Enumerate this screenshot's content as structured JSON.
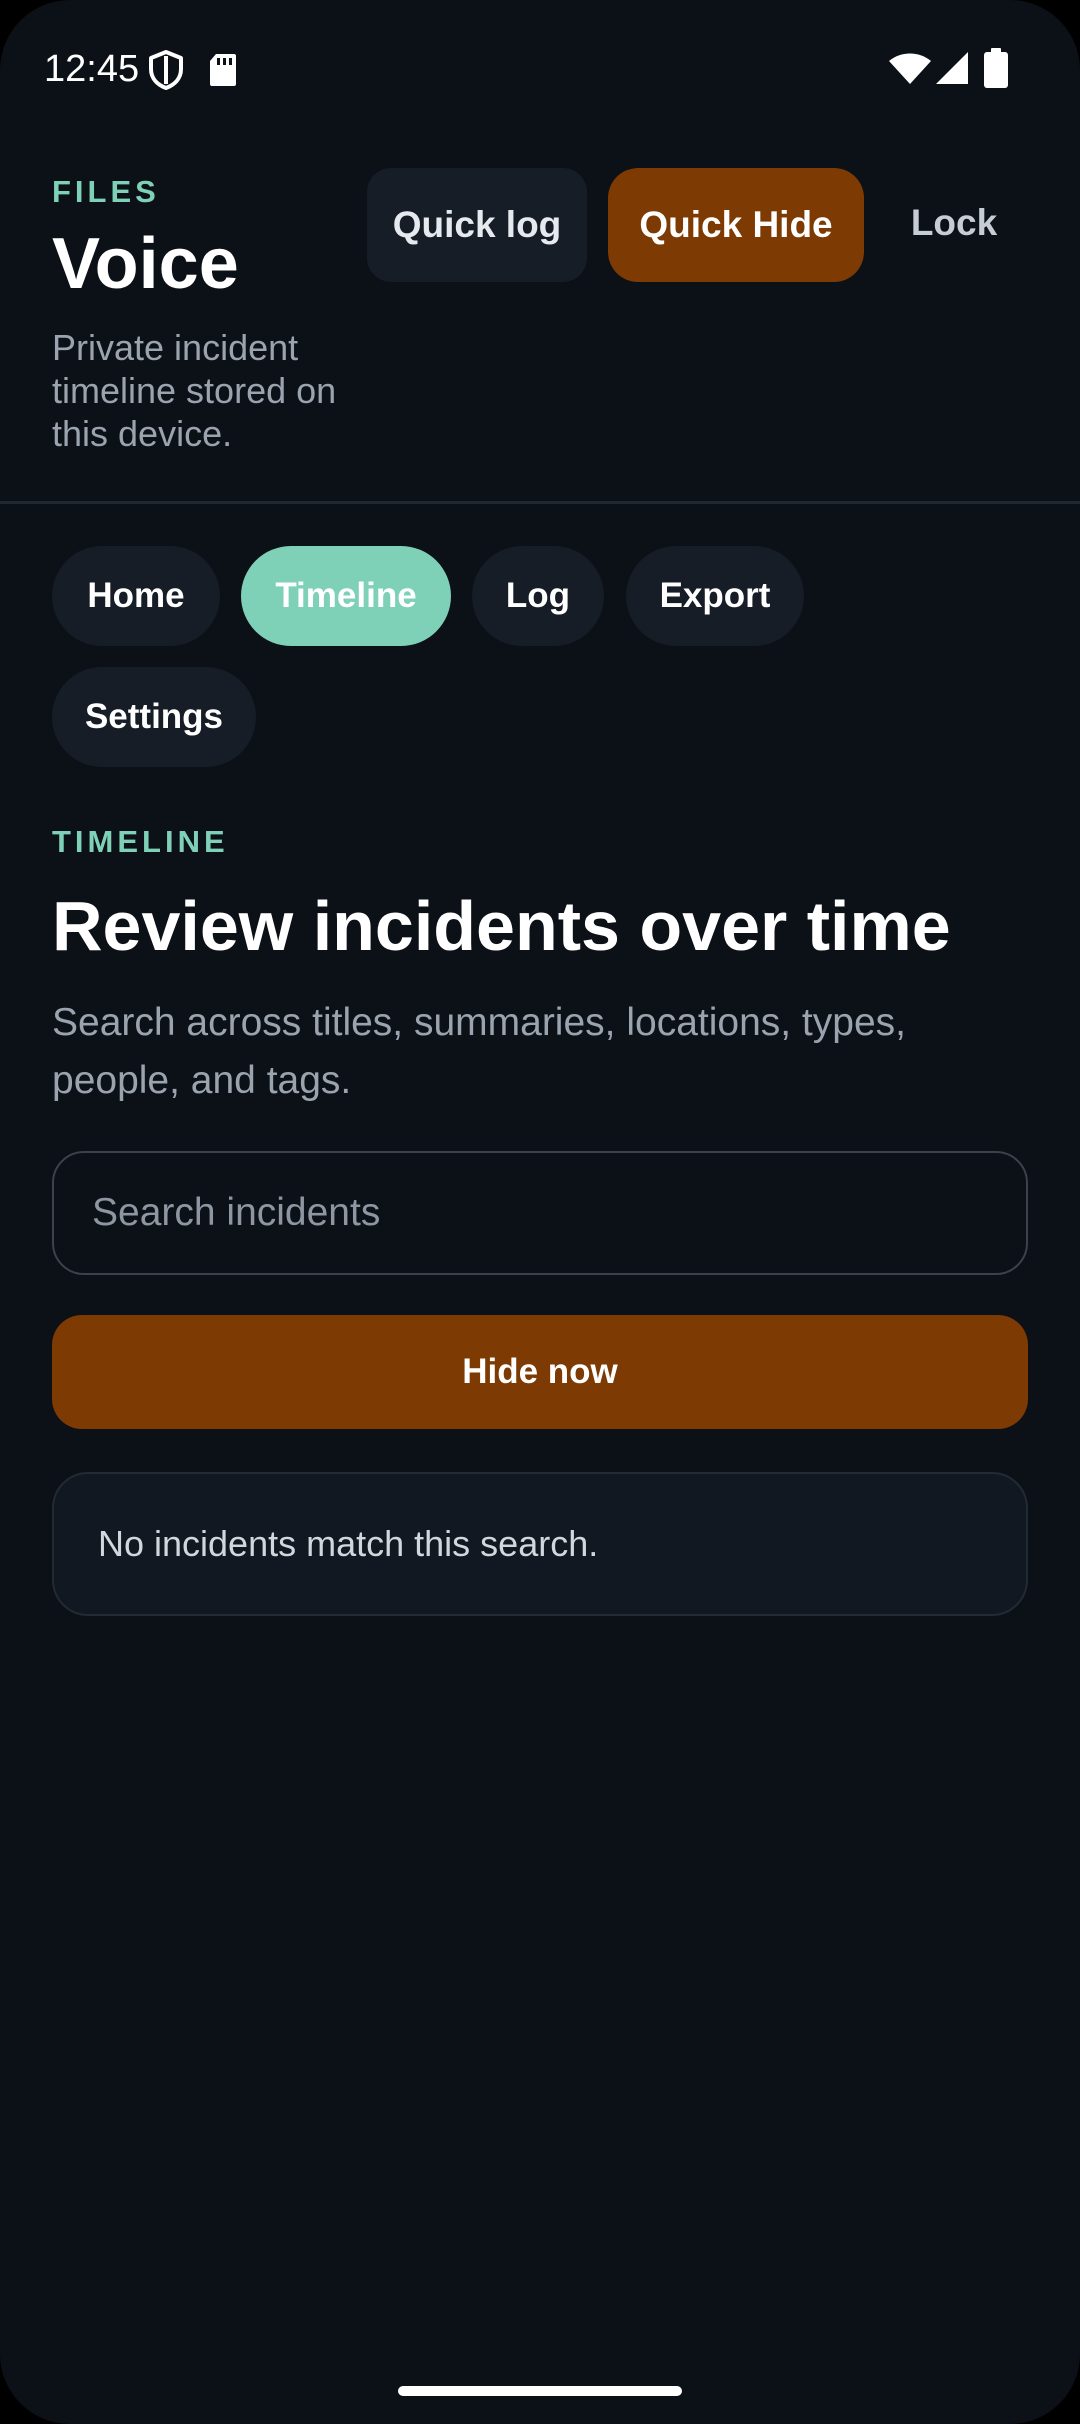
{
  "status_bar": {
    "time": "12:45",
    "icons": [
      "shield-icon",
      "sd-card-icon",
      "wifi-icon",
      "signal-icon",
      "battery-icon"
    ]
  },
  "header": {
    "eyebrow": "FILES",
    "title": "Voice",
    "subtitle": "Private incident timeline stored on this device.",
    "quick_log_label": "Quick log",
    "quick_hide_label": "Quick Hide",
    "lock_label": "Lock"
  },
  "nav": {
    "tabs": [
      {
        "label": "Home",
        "active": false
      },
      {
        "label": "Timeline",
        "active": true
      },
      {
        "label": "Log",
        "active": false
      },
      {
        "label": "Export",
        "active": false
      },
      {
        "label": "Settings",
        "active": false
      }
    ]
  },
  "timeline": {
    "eyebrow": "TIMELINE",
    "title": "Review incidents over time",
    "description": "Search across titles, summaries, locations, types, people, and tags.",
    "search_placeholder": "Search incidents",
    "search_value": "",
    "hide_now_label": "Hide now",
    "empty_message": "No incidents match this search."
  },
  "colors": {
    "background": "#0c1017",
    "accent_teal": "#7ed0b6",
    "accent_orange": "#7d3a02",
    "surface": "#161d26",
    "muted_text": "#9aa3ae"
  }
}
